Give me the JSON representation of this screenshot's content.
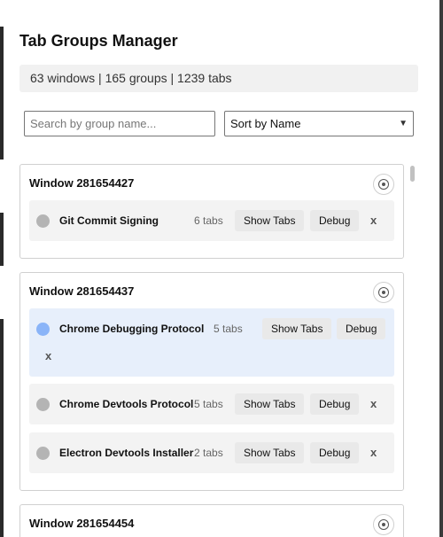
{
  "app": {
    "title": "Tab Groups Manager",
    "stats": "63 windows | 165 groups | 1239 tabs"
  },
  "controls": {
    "search_placeholder": "Search by group name...",
    "sort_selected": "Sort by Name"
  },
  "windows": [
    {
      "title": "Window 281654427",
      "groups": [
        {
          "name": "Git Commit Signing",
          "count": "6 tabs",
          "show": "Show Tabs",
          "debug": "Debug",
          "close": "x",
          "color": "#b4b4b4"
        }
      ]
    },
    {
      "title": "Window 281654437",
      "groups": [
        {
          "name": "Chrome Debugging Protocol",
          "count": "5 tabs",
          "show": "Show Tabs",
          "debug": "Debug",
          "close": "x",
          "color": "#8ab4f8",
          "active": true
        },
        {
          "name": "Chrome Devtools Protocol",
          "count": "5 tabs",
          "show": "Show Tabs",
          "debug": "Debug",
          "close": "x",
          "color": "#b4b4b4"
        },
        {
          "name": "Electron Devtools Installer",
          "count": "2 tabs",
          "show": "Show Tabs",
          "debug": "Debug",
          "close": "x",
          "color": "#b4b4b4"
        }
      ]
    },
    {
      "title": "Window 281654454",
      "groups": []
    }
  ],
  "icons": {
    "focus_window": "target-icon",
    "group_color": "circle-dot-icon",
    "sort_dropdown": "chevron-down-icon"
  }
}
